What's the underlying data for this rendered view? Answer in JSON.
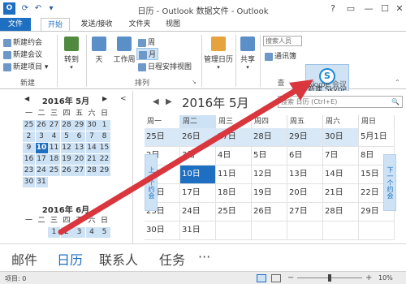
{
  "window": {
    "title": "日历 - Outlook 数据文件 - Outlook"
  },
  "tabs": [
    "文件",
    "开始",
    "发送/接收",
    "文件夹",
    "视图"
  ],
  "ribbon": {
    "new_group": {
      "items": [
        "新建约会",
        "新建会议",
        "新建项目"
      ],
      "label": "新建"
    },
    "goto": "转到",
    "arrange": {
      "day": "天",
      "work_week": "工作周",
      "week": "周",
      "month": "月",
      "schedule": "日程安排视图",
      "label": "排列"
    },
    "manage": "管理日历",
    "share": "共享",
    "find": {
      "search_people": "搜索人员",
      "address_book": "通讯簿",
      "label": "查"
    },
    "skype": {
      "button": "新建 Skype 会议",
      "label": "Skype 会议"
    }
  },
  "mini_cal": {
    "may": {
      "title": "2016年 5月",
      "weekdays": [
        "一",
        "二",
        "三",
        "四",
        "五",
        "六",
        "日"
      ],
      "rows": [
        [
          "25",
          "26",
          "27",
          "28",
          "29",
          "30",
          "1"
        ],
        [
          "2",
          "3",
          "4",
          "5",
          "6",
          "7",
          "8"
        ],
        [
          "9",
          "10",
          "11",
          "12",
          "13",
          "14",
          "15"
        ],
        [
          "16",
          "17",
          "18",
          "19",
          "20",
          "21",
          "22"
        ],
        [
          "23",
          "24",
          "25",
          "26",
          "27",
          "28",
          "29"
        ],
        [
          "30",
          "31",
          "",
          "",
          "",
          "",
          ""
        ]
      ],
      "today": "10"
    },
    "june": {
      "title": "2016年 6月",
      "weekdays": [
        "一",
        "二",
        "三",
        "四",
        "五",
        "六",
        "日"
      ],
      "rows": [
        [
          "",
          "",
          "1",
          "2",
          "3",
          "4",
          "5"
        ]
      ]
    }
  },
  "month_view": {
    "title": "2016年 5月",
    "search_placeholder": "搜索 日历 (Ctrl+E)",
    "headers": [
      "周一",
      "周二",
      "周三",
      "周四",
      "周五",
      "周六",
      "周日"
    ],
    "rows": [
      [
        "25日",
        "26日",
        "27日",
        "28日",
        "29日",
        "30日",
        "5月1日"
      ],
      [
        "2日",
        "3日",
        "4日",
        "5日",
        "6日",
        "7日",
        "8日"
      ],
      [
        "9日",
        "10日",
        "11日",
        "12日",
        "13日",
        "14日",
        "15日"
      ],
      [
        "16日",
        "17日",
        "18日",
        "19日",
        "20日",
        "21日",
        "22日"
      ],
      [
        "23日",
        "24日",
        "25日",
        "26日",
        "27日",
        "28日",
        "29日"
      ],
      [
        "30日",
        "31日",
        "",
        "",
        "",
        "",
        ""
      ]
    ],
    "selected": "10日",
    "prev_appt": "上一个约会",
    "next_appt": "下一个约会"
  },
  "bottom_nav": [
    "邮件",
    "日历",
    "联系人",
    "任务",
    "···"
  ],
  "status": {
    "items": "项目: 0",
    "zoom": "10%"
  },
  "accent": "#1e6fc1",
  "arrow_color": "#d9363e"
}
